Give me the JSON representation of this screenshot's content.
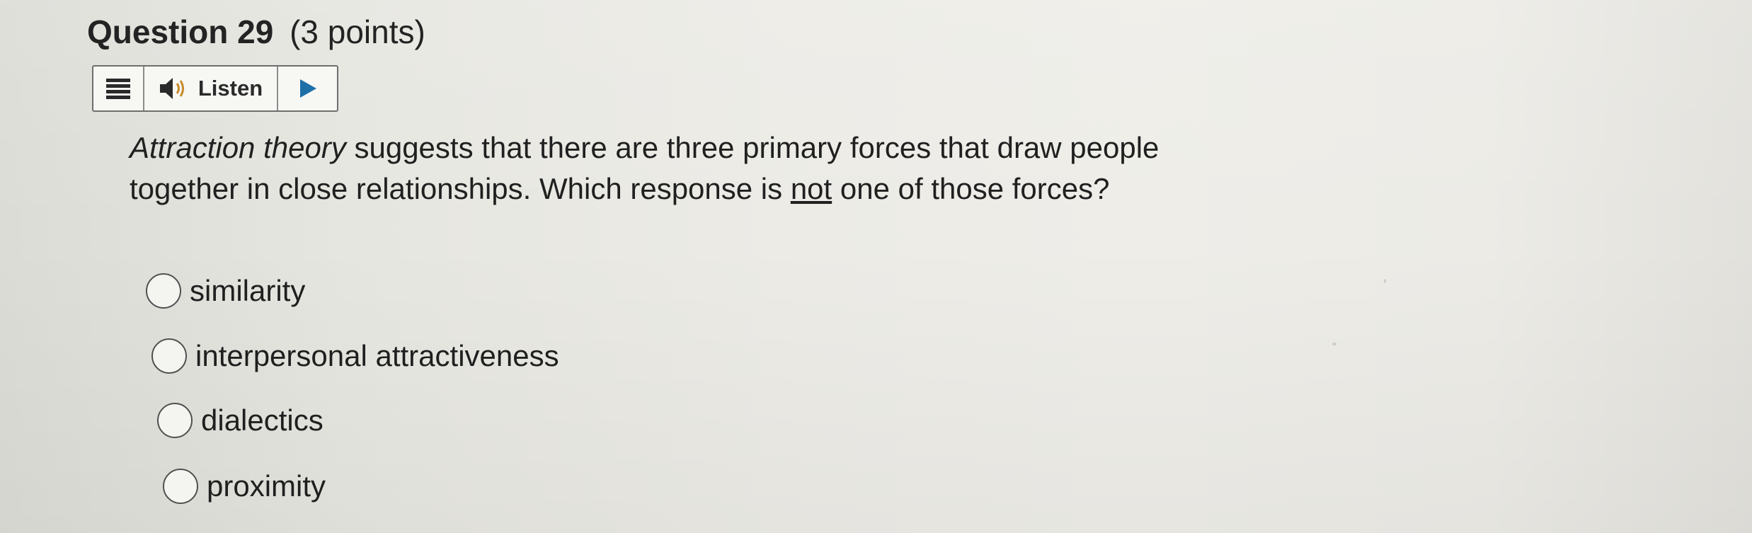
{
  "question": {
    "label": "Question 29",
    "points": "(3 points)"
  },
  "toolbar": {
    "menu_icon": "hamburger-menu-icon",
    "speaker_icon": "speaker-icon",
    "listen_label": "Listen",
    "play_icon": "play-icon"
  },
  "prompt": {
    "italic_term": "Attraction theory",
    "text_part1": " suggests that there are three primary forces that draw people together in close relationships.   Which response is ",
    "underlined_word": "not",
    "text_part2": " one of those forces?"
  },
  "options": [
    {
      "label": "similarity",
      "selected": false
    },
    {
      "label": "interpersonal attractiveness",
      "selected": false
    },
    {
      "label": "dialectics",
      "selected": false
    },
    {
      "label": "proximity",
      "selected": false
    }
  ]
}
